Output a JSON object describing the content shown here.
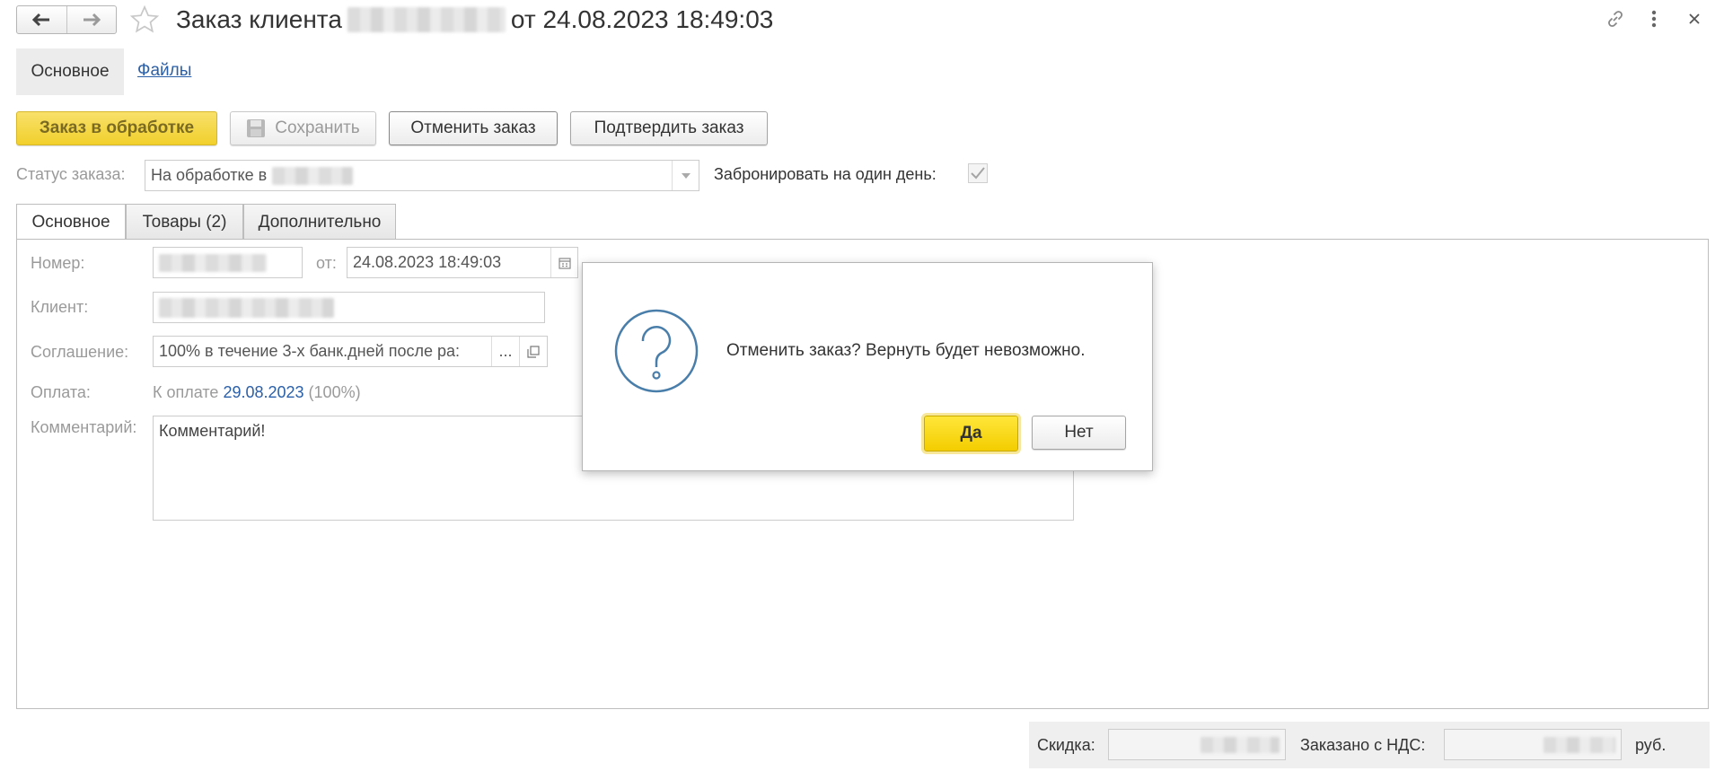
{
  "header": {
    "title_prefix": "Заказ клиента",
    "title_suffix": "от 24.08.2023 18:49:03"
  },
  "nav": {
    "main_label": "Основное",
    "files_label": "Файлы"
  },
  "toolbar": {
    "in_processing_label": "Заказ в обработке",
    "save_label": "Сохранить",
    "cancel_order_label": "Отменить заказ",
    "confirm_order_label": "Подтвердить заказ"
  },
  "status": {
    "label": "Статус заказа:",
    "value": "На обработке в",
    "reserve_label": "Забронировать на один день:",
    "reserve_checked": true
  },
  "tabs": [
    {
      "label": "Основное",
      "active": true
    },
    {
      "label": "Товары (2)",
      "active": false
    },
    {
      "label": "Дополнительно",
      "active": false
    }
  ],
  "form": {
    "number_label": "Номер:",
    "from_label": "от:",
    "date_value": "24.08.2023 18:49:03",
    "client_label": "Клиент:",
    "agreement_label": "Соглашение:",
    "agreement_value": "100% в течение 3-х банк.дней после ра:",
    "agreement_more": "...",
    "payment_label": "Оплата:",
    "payment_prefix": "К оплате",
    "payment_date": "29.08.2023",
    "payment_percent": "(100%)",
    "comment_label": "Комментарий:",
    "comment_value": "Комментарий!"
  },
  "dialog": {
    "message": "Отменить заказ? Вернуть будет невозможно.",
    "yes_label": "Да",
    "no_label": "Нет"
  },
  "footer": {
    "discount_label": "Скидка:",
    "ordered_vat_label": "Заказано с НДС:",
    "currency": "руб."
  },
  "colors": {
    "accent_yellow": "#f5d532",
    "link_blue": "#2b5fa8",
    "question_blue": "#4a7eaa"
  }
}
